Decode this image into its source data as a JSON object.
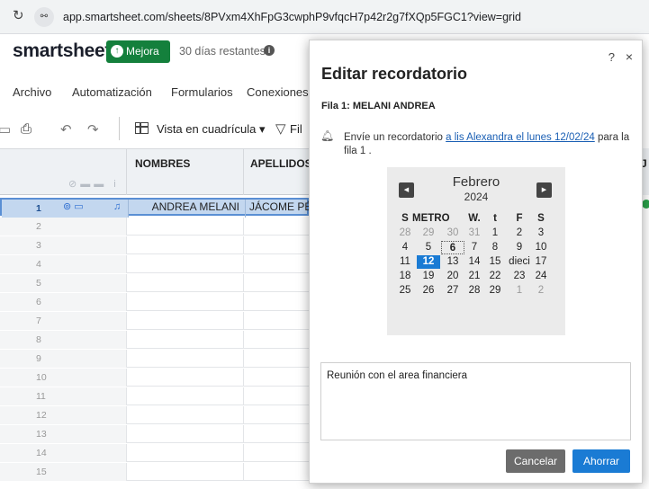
{
  "browser": {
    "url": "app.smartsheet.com/sheets/8PVxm4XhFpG3cwphP9vfqcH7p42r2g7fXQp5FGC1?view=grid"
  },
  "app": {
    "brand": "smartsheet",
    "upgrade_label": "Mejora",
    "trial_text": "30 días restantes"
  },
  "menu": [
    "Archivo",
    "Automatización",
    "Formularios",
    "Conexiones"
  ],
  "toolbar": {
    "view_label": "Vista en cuadrícula",
    "view_caret": "▾",
    "filter_label": "Fil"
  },
  "grid": {
    "columns": [
      "NOMBRES",
      "APELLIDOS"
    ],
    "right_col_label": "J",
    "selected_row": {
      "number": "1",
      "nombres": "ANDREA MELANI",
      "apellidos": "JÁCOME PÉ"
    },
    "row_numbers": [
      "2",
      "3",
      "4",
      "5",
      "6",
      "7",
      "8",
      "9",
      "10",
      "11",
      "12",
      "13",
      "14",
      "15"
    ]
  },
  "modal": {
    "help": "?",
    "close": "×",
    "title": "Editar recordatorio",
    "row_ref": "Fila 1: MELANI ANDREA",
    "reminder_prefix": "Envíe un recordatorio",
    "reminder_link": "a lis Alexandra el lunes 12/02/24",
    "reminder_suffix": "para la fila 1 .",
    "message": "Reunión con el area financiera",
    "cancel_label": "Cancelar",
    "save_label": "Ahorrar"
  },
  "calendar": {
    "month": "Febrero",
    "year": "2024",
    "weekdays": [
      "S",
      "METRO",
      "W.",
      "t",
      "F",
      "S"
    ],
    "weeks": [
      [
        "28",
        "29",
        "30",
        "31",
        "1",
        "2",
        "3"
      ],
      [
        "4",
        "5",
        "6",
        "7",
        "8",
        "9",
        "10"
      ],
      [
        "11",
        "12",
        "13",
        "14",
        "15",
        "dieci",
        "17"
      ],
      [
        "18",
        "19",
        "20",
        "21",
        "22",
        "23",
        "24"
      ],
      [
        "25",
        "26",
        "27",
        "28",
        "29",
        "1",
        "2"
      ]
    ],
    "selected_day": "12",
    "today_day": "6"
  }
}
